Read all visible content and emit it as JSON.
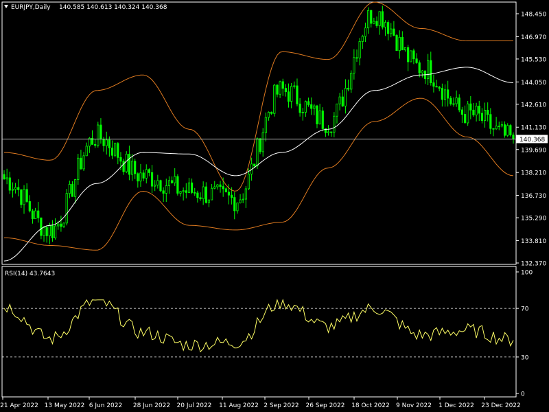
{
  "header": {
    "symbol": "EURJPY,Daily",
    "ohlc": "140.585 140.613 140.324 140.368",
    "menu_icon": "triangle-down-icon"
  },
  "rsi_header": {
    "label": "RSI(14) 43.7643"
  },
  "current_price": {
    "label": "140.368",
    "value": 140.368
  },
  "colors": {
    "background": "#000000",
    "frame": "#ffffff",
    "candles": "#00ff00",
    "bands": "#e07b20",
    "moving_average": "#ffffff",
    "rsi_line": "#ffff66"
  },
  "chart_data": [
    {
      "type": "candlestick",
      "ylim": [
        132.37,
        149.2
      ],
      "yticks": [
        132.37,
        133.81,
        135.29,
        136.73,
        138.21,
        139.69,
        141.13,
        142.61,
        144.05,
        145.53,
        146.97,
        148.45
      ],
      "ytick_labels": [
        "132.370",
        "133.810",
        "135.290",
        "136.730",
        "138.210",
        "139.690",
        "141.130",
        "142.610",
        "144.050",
        "145.530",
        "146.970",
        "148.450"
      ],
      "x_dates": [
        "21 Apr 2022",
        "13 May 2022",
        "6 Jun 2022",
        "28 Jun 2022",
        "20 Jul 2022",
        "11 Aug 2022",
        "2 Sep 2022",
        "26 Sep 2022",
        "18 Oct 2022",
        "9 Nov 2022",
        "1 Dec 2022",
        "23 Dec 2022"
      ],
      "close_path": {
        "dates": [
          "21 Apr 2022",
          "13 May 2022",
          "6 Jun 2022",
          "28 Jun 2022",
          "20 Jul 2022",
          "11 Aug 2022",
          "2 Sep 2022",
          "26 Sep 2022",
          "18 Oct 2022",
          "9 Nov 2022",
          "1 Dec 2022",
          "23 Dec 2022"
        ],
        "values": [
          137.8,
          134.5,
          140.5,
          138.0,
          137.0,
          136.5,
          143.5,
          141.5,
          148.5,
          145.0,
          142.0,
          140.4
        ]
      },
      "series": [
        {
          "name": "",
          "kind": "bollinger-upper",
          "values": [
            139.5,
            139.0,
            143.5,
            144.5,
            141.0,
            137.0,
            146.0,
            145.5,
            149.2,
            147.5,
            146.7,
            146.7
          ]
        },
        {
          "name": "",
          "kind": "bollinger-lower",
          "values": [
            134.0,
            133.5,
            133.2,
            137.0,
            134.8,
            134.5,
            135.0,
            138.5,
            141.5,
            143.0,
            140.5,
            138.0
          ]
        },
        {
          "name": "",
          "kind": "moving-average",
          "values": [
            132.5,
            134.8,
            137.5,
            139.5,
            139.4,
            138.0,
            139.5,
            141.0,
            143.5,
            144.5,
            145.0,
            144.0
          ]
        }
      ]
    },
    {
      "type": "line",
      "title": "RSI(14) 43.7643",
      "ylim": [
        0,
        100
      ],
      "yticks": [
        0,
        30,
        70,
        100
      ],
      "levels": [
        30,
        70
      ],
      "x_dates": [
        "21 Apr 2022",
        "13 May 2022",
        "6 Jun 2022",
        "28 Jun 2022",
        "20 Jul 2022",
        "11 Aug 2022",
        "2 Sep 2022",
        "26 Sep 2022",
        "18 Oct 2022",
        "9 Nov 2022",
        "1 Dec 2022",
        "23 Dec 2022"
      ],
      "values": [
        72,
        45,
        76,
        50,
        40,
        42,
        75,
        55,
        70,
        48,
        52,
        44
      ]
    }
  ]
}
